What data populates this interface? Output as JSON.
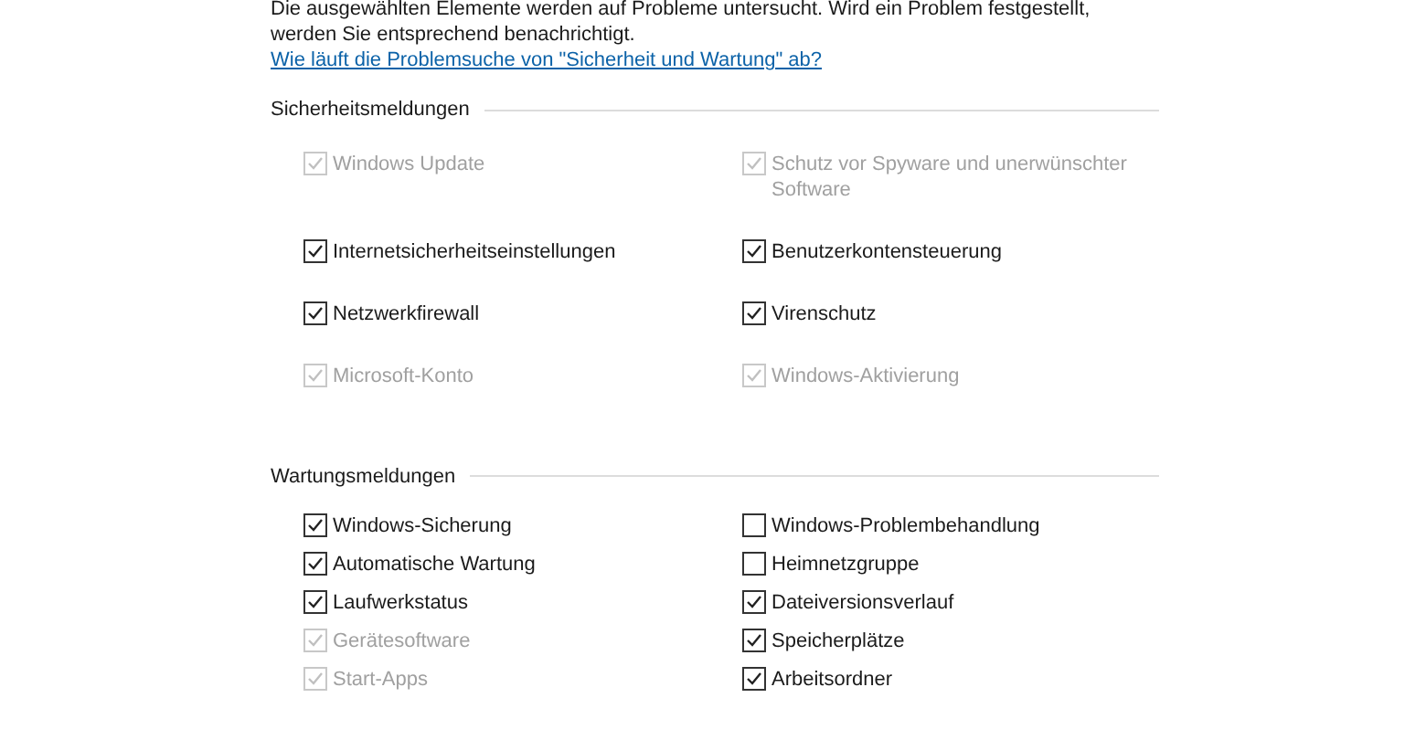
{
  "intro": {
    "text": "Die ausgewählten Elemente werden auf Probleme untersucht. Wird ein Problem festgestellt, werden Sie entsprechend benachrichtigt.",
    "link": "Wie läuft die Problemsuche von \"Sicherheit und Wartung\" ab?"
  },
  "sections": [
    {
      "title": "Sicherheitsmeldungen",
      "items": [
        {
          "label": "Windows Update",
          "checked": true,
          "disabled": true
        },
        {
          "label": "Schutz vor Spyware und unerwünschter Software",
          "checked": true,
          "disabled": true
        },
        {
          "label": "Internetsicherheitseinstellungen",
          "checked": true,
          "disabled": false
        },
        {
          "label": "Benutzerkontensteuerung",
          "checked": true,
          "disabled": false
        },
        {
          "label": "Netzwerkfirewall",
          "checked": true,
          "disabled": false
        },
        {
          "label": "Virenschutz",
          "checked": true,
          "disabled": false
        },
        {
          "label": "Microsoft-Konto",
          "checked": true,
          "disabled": true
        },
        {
          "label": "Windows-Aktivierung",
          "checked": true,
          "disabled": true
        }
      ]
    },
    {
      "title": "Wartungsmeldungen",
      "items": [
        {
          "label": "Windows-Sicherung",
          "checked": true,
          "disabled": false
        },
        {
          "label": "Windows-Problembehandlung",
          "checked": false,
          "disabled": false
        },
        {
          "label": "Automatische Wartung",
          "checked": true,
          "disabled": false
        },
        {
          "label": "Heimnetzgruppe",
          "checked": false,
          "disabled": false
        },
        {
          "label": "Laufwerkstatus",
          "checked": true,
          "disabled": false
        },
        {
          "label": "Dateiversionsverlauf",
          "checked": true,
          "disabled": false
        },
        {
          "label": "Gerätesoftware",
          "checked": true,
          "disabled": true
        },
        {
          "label": "Speicherplätze",
          "checked": true,
          "disabled": false
        },
        {
          "label": "Start-Apps",
          "checked": true,
          "disabled": true
        },
        {
          "label": "Arbeitsordner",
          "checked": true,
          "disabled": false
        }
      ]
    }
  ]
}
